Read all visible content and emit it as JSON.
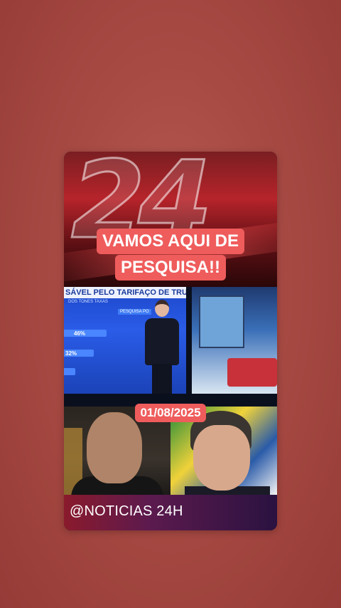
{
  "card": {
    "headline_line1": "VAMOS AQUI DE",
    "headline_line2": "PESQUISA!!",
    "date": "01/08/2025",
    "footer_handle": "@NOTICIAS 24H"
  },
  "tv_screen": {
    "title": "SÁVEL PELO TARIFAÇO DE TRUMP",
    "subtitle": "DOS TONES TAXAS",
    "tag": "PESQUISA PO",
    "bars": [
      {
        "label": "46%",
        "value": 46
      },
      {
        "label": "32%",
        "value": 32
      },
      {
        "label": "",
        "value": 12
      }
    ]
  },
  "colors": {
    "background": "#a84a44",
    "label_red": "#ef5c5c"
  }
}
